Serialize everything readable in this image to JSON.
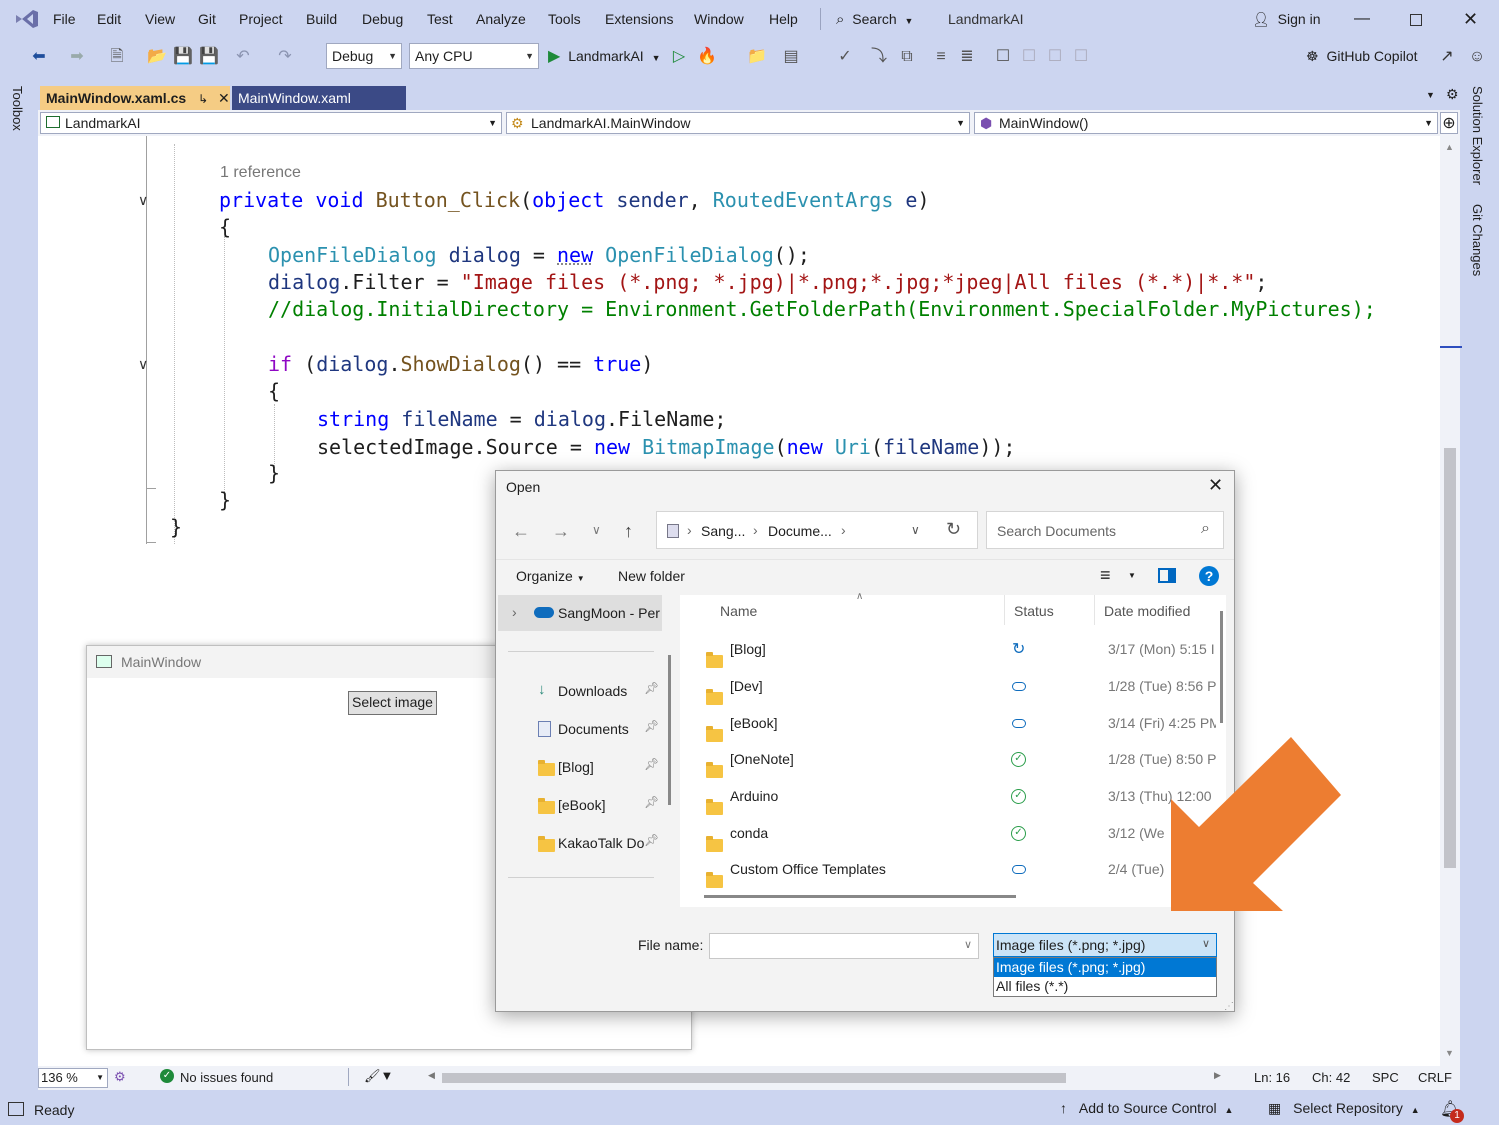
{
  "menubar": {
    "items": [
      "File",
      "Edit",
      "View",
      "Git",
      "Project",
      "Build",
      "Debug",
      "Test",
      "Analyze",
      "Tools",
      "Extensions",
      "Window",
      "Help"
    ],
    "search_label": "Search",
    "solution_name": "LandmarkAI",
    "sign_in": "Sign in"
  },
  "toolbar": {
    "config": "Debug",
    "platform": "Any CPU",
    "run_target": "LandmarkAI",
    "copilot": "GitHub Copilot"
  },
  "rails": {
    "left": "Toolbox",
    "right_1": "Solution Explorer",
    "right_2": "Git Changes"
  },
  "tabs": [
    {
      "label": "MainWindow.xaml.cs",
      "active": true
    },
    {
      "label": "MainWindow.xaml",
      "active": false
    }
  ],
  "nav": {
    "project": "LandmarkAI",
    "class": "LandmarkAI.MainWindow",
    "member": "MainWindow()"
  },
  "code": {
    "reference": "1 reference",
    "lines": {
      "l1": [
        "private",
        "void",
        "Button_Click",
        "(",
        "object",
        "sender",
        ", ",
        "RoutedEventArgs",
        "e",
        ")"
      ],
      "l2": "{",
      "l3": [
        "OpenFileDialog",
        "dialog",
        " = ",
        "new",
        "OpenFileDialog",
        "();"
      ],
      "l4": [
        "dialog",
        ".",
        "Filter",
        " = ",
        "\"Image files (*.png; *.jpg)|*.png;*.jpg;*jpeg|All files (*.*)|*.*\"",
        ";"
      ],
      "l5": "//dialog.InitialDirectory = Environment.GetFolderPath(Environment.SpecialFolder.MyPictures);",
      "l6": [
        "if",
        " (",
        "dialog",
        ".",
        "ShowDialog",
        "() == ",
        "true",
        ")"
      ],
      "l7": "{",
      "l8": [
        "string",
        "fileName",
        " = ",
        "dialog",
        ".",
        "FileName",
        ";"
      ],
      "l9": [
        "selectedImage",
        ".",
        "Source",
        " = ",
        "new",
        "BitmapImage",
        "(",
        "new",
        "Uri",
        "(",
        "fileName",
        "));"
      ],
      "l10": "}",
      "l11": "}",
      "l12": "}"
    }
  },
  "editor_status": {
    "zoom": "136 %",
    "issues": "No issues found",
    "ln": "Ln: 16",
    "ch": "Ch: 42",
    "spc": "SPC",
    "crlf": "CRLF"
  },
  "statusbar": {
    "ready": "Ready",
    "source_control": "Add to Source Control",
    "repo": "Select Repository",
    "notif_count": "1"
  },
  "mainwindow": {
    "title": "MainWindow",
    "button": "Select image"
  },
  "open_dialog": {
    "title": "Open",
    "breadcrumb": [
      "Sang...",
      "Docume..."
    ],
    "search_placeholder": "Search Documents",
    "organize": "Organize",
    "new_folder": "New folder",
    "nav_top": "SangMoon - Per",
    "nav_items": [
      "Downloads",
      "Documents",
      "[Blog]",
      "[eBook]",
      "KakaoTalk Do"
    ],
    "columns": {
      "name": "Name",
      "status": "Status",
      "date": "Date modified"
    },
    "files": [
      {
        "name": "[Blog]",
        "status": "sync",
        "date": "3/17 (Mon) 5:15 I"
      },
      {
        "name": "[Dev]",
        "status": "cloud",
        "date": "1/28 (Tue) 8:56 P"
      },
      {
        "name": "[eBook]",
        "status": "cloud",
        "date": "3/14 (Fri) 4:25 PM"
      },
      {
        "name": "[OneNote]",
        "status": "ok",
        "date": "1/28 (Tue) 8:50 P"
      },
      {
        "name": "Arduino",
        "status": "ok",
        "date": "3/13 (Thu) 12:00"
      },
      {
        "name": "conda",
        "status": "ok",
        "date": "3/12 (We"
      },
      {
        "name": "Custom Office Templates",
        "status": "cloud",
        "date": "2/4 (Tue)"
      }
    ],
    "filename_label": "File name:",
    "filename_value": "",
    "filter_selected": "Image files (*.png; *.jpg)",
    "filter_options": [
      "Image files (*.png; *.jpg)",
      "All files (*.*)"
    ]
  },
  "colors": {
    "accent": "#0078d4",
    "arrow": "#ed7d31",
    "chrome": "#ccd5f0",
    "tab_active": "#f5cc84"
  }
}
